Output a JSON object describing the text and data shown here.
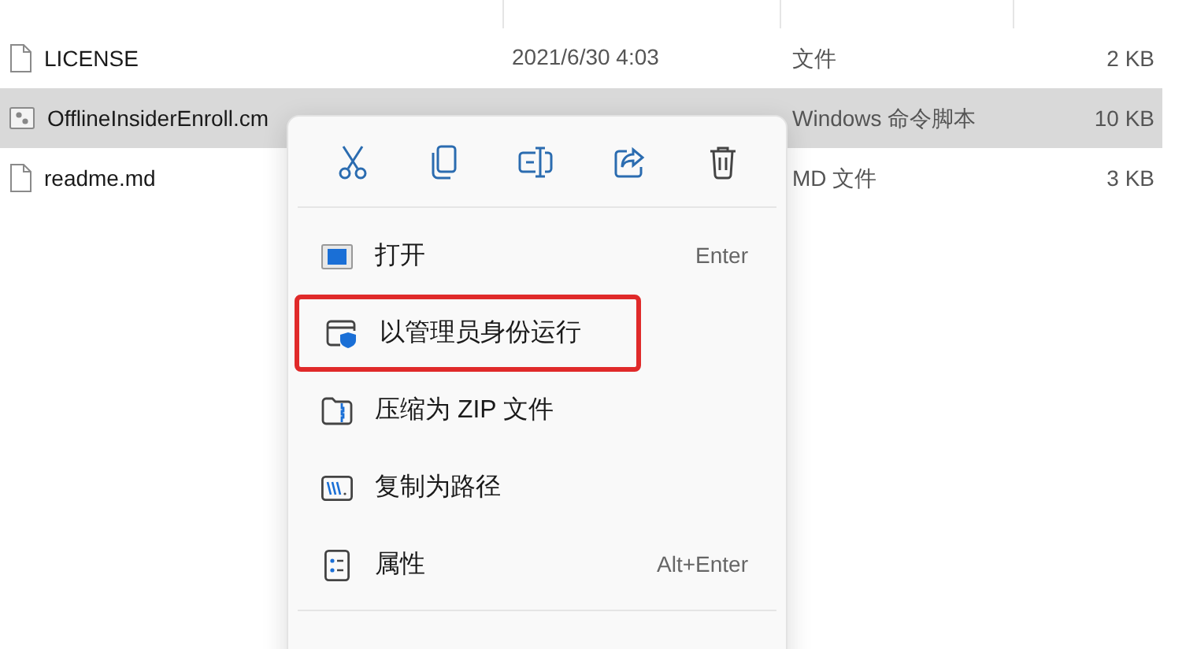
{
  "files": [
    {
      "name": "LICENSE",
      "modified": "2021/6/30 4:03",
      "type": "文件",
      "size": "2 KB",
      "selected": false,
      "kind": "text"
    },
    {
      "name": "OfflineInsiderEnroll.cm",
      "type": "Windows 命令脚本",
      "size": "10 KB",
      "selected": true,
      "kind": "script"
    },
    {
      "name": "readme.md",
      "type": "MD 文件",
      "size": "3 KB",
      "selected": false,
      "kind": "text"
    }
  ],
  "context_menu": {
    "toolbar": [
      {
        "kind": "cut"
      },
      {
        "kind": "copy"
      },
      {
        "kind": "rename"
      },
      {
        "kind": "share"
      },
      {
        "kind": "delete"
      }
    ],
    "items": [
      {
        "kind": "open",
        "label": "打开",
        "shortcut": "Enter",
        "highlighted": false
      },
      {
        "kind": "admin",
        "label": "以管理员身份运行",
        "highlighted": true
      },
      {
        "kind": "zip",
        "label": "压缩为 ZIP 文件",
        "highlighted": false
      },
      {
        "kind": "path",
        "label": "复制为路径",
        "highlighted": false
      },
      {
        "kind": "properties",
        "label": "属性",
        "shortcut": "Alt+Enter",
        "highlighted": false
      }
    ]
  }
}
